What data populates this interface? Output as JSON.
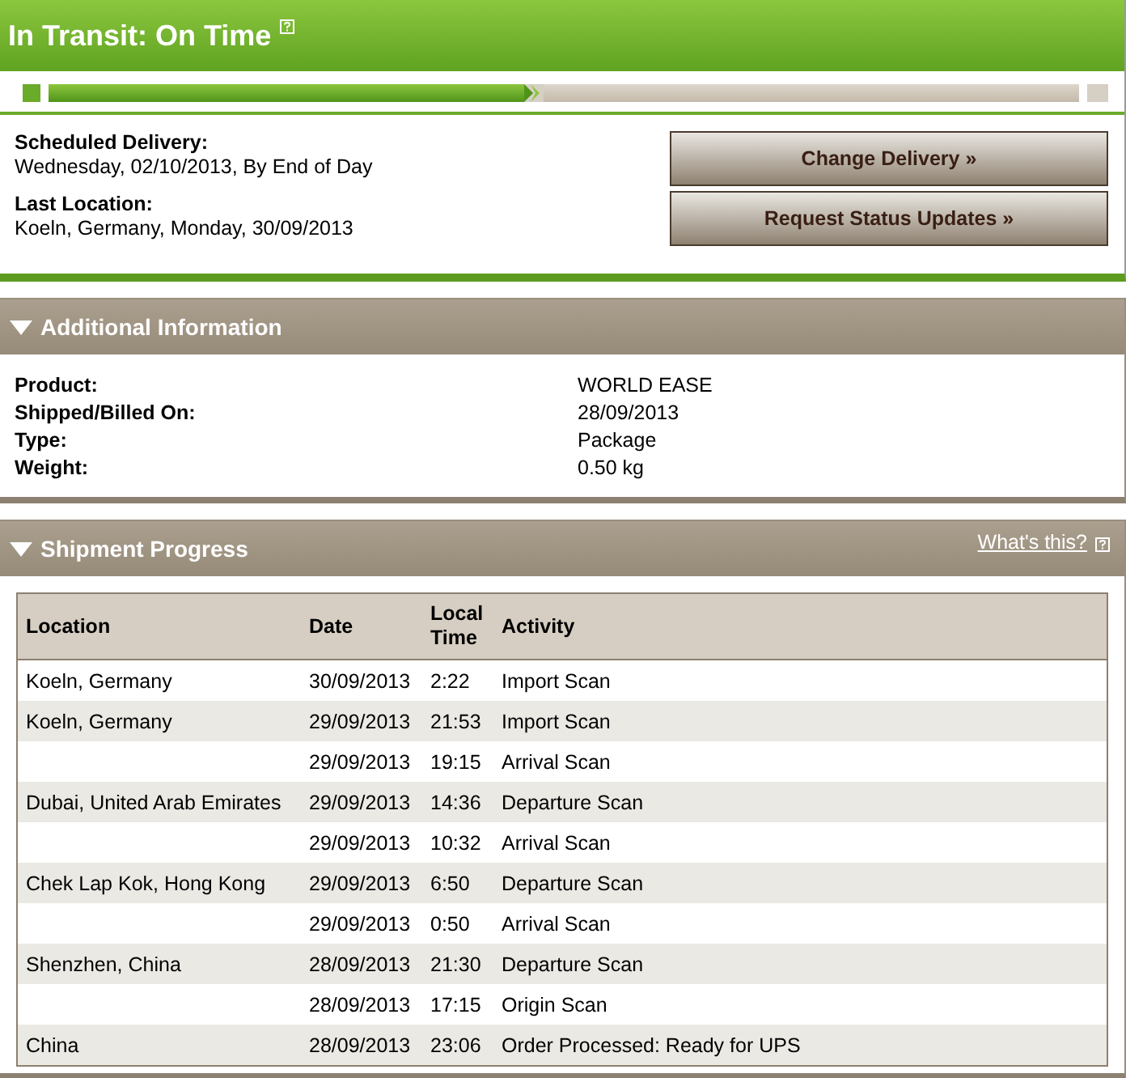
{
  "status": {
    "title": "In Transit: On Time"
  },
  "progress": {
    "level": 0.48
  },
  "delivery": [
    {
      "label": "Scheduled Delivery:",
      "value": "Wednesday, 02/10/2013, By End of Day"
    },
    {
      "label": "Last Location:",
      "value": "Koeln, Germany, Monday, 30/09/2013"
    }
  ],
  "buttons": [
    "Change Delivery »",
    "Request Status Updates »"
  ],
  "additional_info": {
    "title": "Additional Information",
    "expanded": true,
    "fields": [
      {
        "label": "Product:",
        "value": "WORLD EASE"
      },
      {
        "label": "Shipped/Billed On:",
        "value": "28/09/2013"
      },
      {
        "label": "Type:",
        "value": "Package"
      },
      {
        "label": "Weight:",
        "value": "0.50 kg"
      }
    ]
  },
  "shipment_progress": {
    "title": "Shipment Progress",
    "expanded": true,
    "help_link": "What's this?",
    "table": {
      "columns": [
        "Location",
        "Date",
        "Local Time",
        "Activity"
      ],
      "rows": [
        {
          "location": "Koeln, Germany",
          "date": "30/09/2013",
          "time": "2:22",
          "activity": "Import Scan"
        },
        {
          "location": "Koeln, Germany",
          "date": "29/09/2013",
          "time": "21:53",
          "activity": "Import Scan"
        },
        {
          "date": "29/09/2013",
          "time": "19:15",
          "activity": "Arrival Scan"
        },
        {
          "location": "Dubai, United Arab Emirates",
          "date": "29/09/2013",
          "time": "14:36",
          "activity": "Departure Scan"
        },
        {
          "date": "29/09/2013",
          "time": "10:32",
          "activity": "Arrival Scan"
        },
        {
          "location": "Chek Lap Kok, Hong Kong",
          "date": "29/09/2013",
          "time": "6:50",
          "activity": "Departure Scan"
        },
        {
          "date": "29/09/2013",
          "time": "0:50",
          "activity": "Arrival Scan"
        },
        {
          "location": "Shenzhen, China",
          "date": "28/09/2013",
          "time": "21:30",
          "activity": "Departure Scan"
        },
        {
          "date": "28/09/2013",
          "time": "17:15",
          "activity": "Origin Scan"
        },
        {
          "location": "China",
          "date": "28/09/2013",
          "time": "23:06",
          "activity": "Order Processed: Ready for UPS"
        }
      ]
    }
  }
}
